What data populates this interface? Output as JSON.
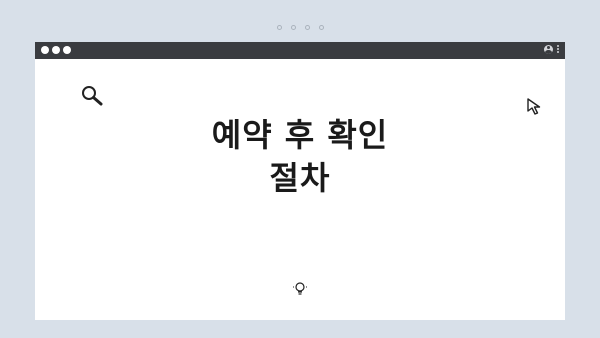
{
  "title_lines": [
    "예약 후 확인",
    "절차"
  ],
  "icons": {
    "search": "search-icon",
    "cursor": "cursor-icon",
    "bulb": "lightbulb-icon",
    "profile": "profile-icon",
    "menu": "kebab-menu-icon"
  },
  "colors": {
    "background": "#d8e0e9",
    "titlebar": "#3a3c40",
    "window": "#ffffff",
    "text": "#1a1a1a"
  }
}
